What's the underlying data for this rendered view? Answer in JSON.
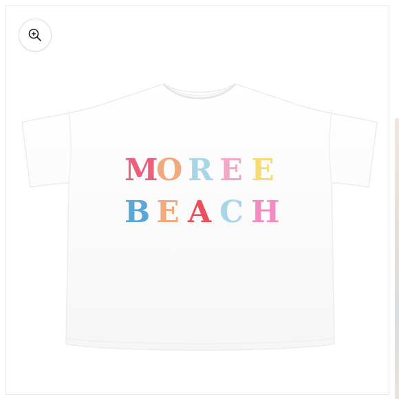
{
  "zoom_button": {
    "icon": "zoom-in-icon"
  },
  "product": {
    "print_line_1": [
      {
        "char": "M",
        "color": "#e8607a"
      },
      {
        "char": "O",
        "color": "#f2a97e"
      },
      {
        "char": "R",
        "color": "#a8d6e6"
      },
      {
        "char": "E",
        "color": "#f4a6c6"
      },
      {
        "char": "E",
        "color": "#f6dc73"
      }
    ],
    "print_line_2": [
      {
        "char": "B",
        "color": "#5aa6d6"
      },
      {
        "char": "E",
        "color": "#f2a97e"
      },
      {
        "char": "A",
        "color": "#e8505b"
      },
      {
        "char": "C",
        "color": "#a8d6e6"
      },
      {
        "char": "H",
        "color": "#f28cc0"
      }
    ]
  }
}
